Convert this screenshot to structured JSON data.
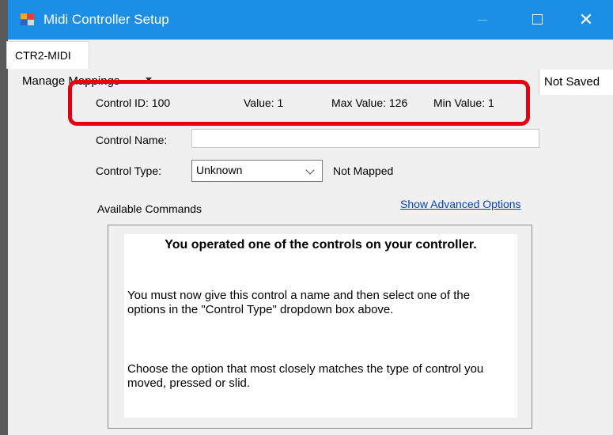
{
  "window": {
    "title": "Midi Controller Setup",
    "title_bar_color": "#1c8ee6",
    "close_glyph": "✕"
  },
  "tabs": [
    {
      "label": "CTR2-MIDI",
      "selected": true
    }
  ],
  "menu": {
    "manage_mappings": "Manage Mappings",
    "save_status": "Not Saved"
  },
  "control_info": {
    "control_id": "Control ID: 100",
    "value": "Value: 1",
    "max_value": "Max Value: 126",
    "min_value": "Min Value: 1",
    "highlight_color": "#e3000f"
  },
  "form": {
    "control_name_label": "Control Name:",
    "control_name_value": "",
    "control_type_label": "Control Type:",
    "control_type_value": "Unknown",
    "mapping_status": "Not Mapped"
  },
  "commands": {
    "available_label": "Available Commands",
    "advanced_link": "Show Advanced Options",
    "link_color": "#0645ad"
  },
  "message": {
    "heading": "You operated one of the controls on your controller.",
    "para1": "You must now give this control a name and then select one of the options in the \"Control Type\" dropdown box above.",
    "para2": "Choose the option that most closely matches the type of control you moved, pressed or slid."
  },
  "icons": {
    "app": "app-window-icon",
    "minimize": "minimize-icon",
    "maximize": "maximize-icon",
    "close": "close-icon",
    "dropdown": "chevron-down-icon",
    "menu_arrow": "caret-down-icon"
  }
}
